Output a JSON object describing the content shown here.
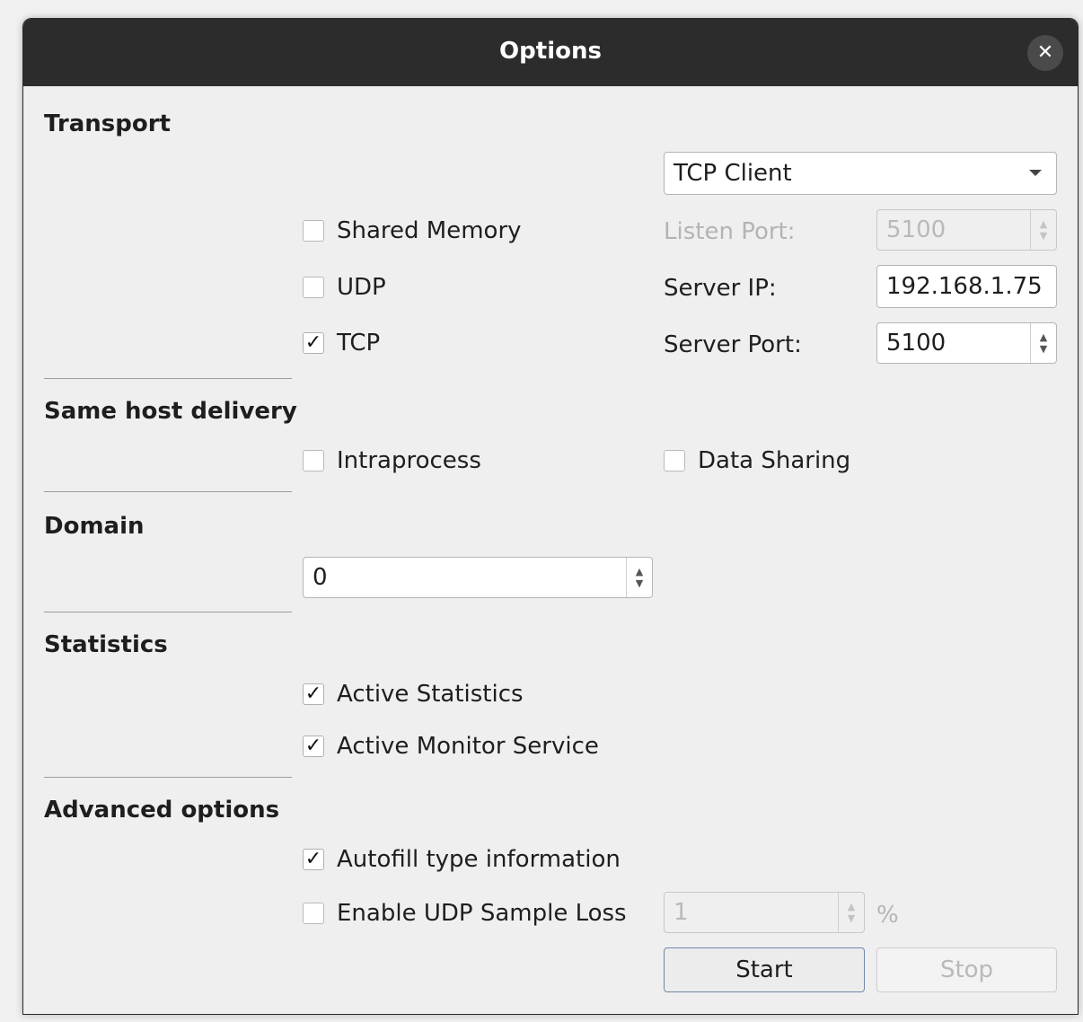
{
  "window": {
    "title": "Options",
    "close_icon": "close-icon"
  },
  "transport": {
    "title": "Transport",
    "mode": {
      "selected": "TCP Client"
    },
    "shared_memory": {
      "label": "Shared Memory",
      "checked": false
    },
    "udp": {
      "label": "UDP",
      "checked": false
    },
    "tcp": {
      "label": "TCP",
      "checked": true
    },
    "listen_port": {
      "label": "Listen Port:",
      "value": "5100",
      "enabled": false
    },
    "server_ip": {
      "label": "Server IP:",
      "value": "192.168.1.75"
    },
    "server_port": {
      "label": "Server Port:",
      "value": "5100"
    }
  },
  "same_host": {
    "title": "Same host delivery",
    "intraprocess": {
      "label": "Intraprocess",
      "checked": false
    },
    "data_sharing": {
      "label": "Data Sharing",
      "checked": false
    }
  },
  "domain": {
    "title": "Domain",
    "value": "0"
  },
  "statistics": {
    "title": "Statistics",
    "active_statistics": {
      "label": "Active Statistics",
      "checked": true
    },
    "active_monitor": {
      "label": "Active Monitor Service",
      "checked": true
    }
  },
  "advanced": {
    "title": "Advanced options",
    "autofill": {
      "label": "Autofill type information",
      "checked": true
    },
    "udp_loss": {
      "label": "Enable UDP Sample Loss",
      "checked": false,
      "value": "1",
      "unit": "%"
    }
  },
  "buttons": {
    "start": "Start",
    "stop": "Stop"
  },
  "check_mark": "✓"
}
